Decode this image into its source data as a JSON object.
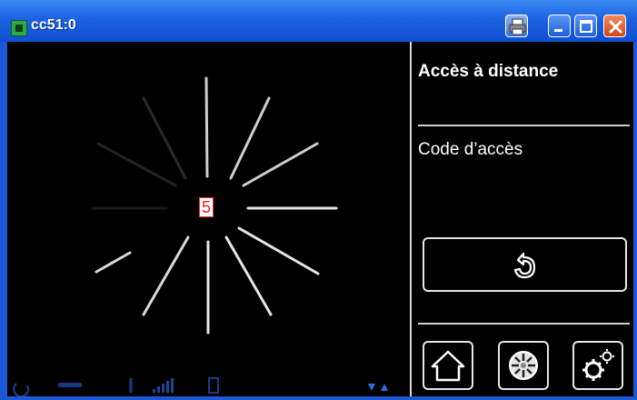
{
  "window": {
    "title": "cc51:0",
    "icons": [
      "app-icon",
      "printer-icon",
      "minimize-icon",
      "maximize-icon",
      "close-icon"
    ]
  },
  "spinner": {
    "value": "5"
  },
  "right_panel": {
    "title": "Accès à distance",
    "code_label": "Code d’accès",
    "back_icon": "back-arrow-icon",
    "nav": [
      {
        "id": "home",
        "icon": "home-icon"
      },
      {
        "id": "display",
        "icon": "radial-display-icon"
      },
      {
        "id": "settings",
        "icon": "gears-icon"
      }
    ]
  },
  "status_bar": {
    "icons": [
      "refresh-icon",
      "link-icon",
      "antenna-icon",
      "signal-bars-icon",
      "device-icon",
      "transfer-arrows-icon"
    ]
  },
  "colors": {
    "titlebar": "#1d62e0",
    "screen_bg": "#000000",
    "foreground": "#ffffff",
    "status_icons": "#1c3f8a",
    "spinner_number": "#ff1a1a"
  }
}
